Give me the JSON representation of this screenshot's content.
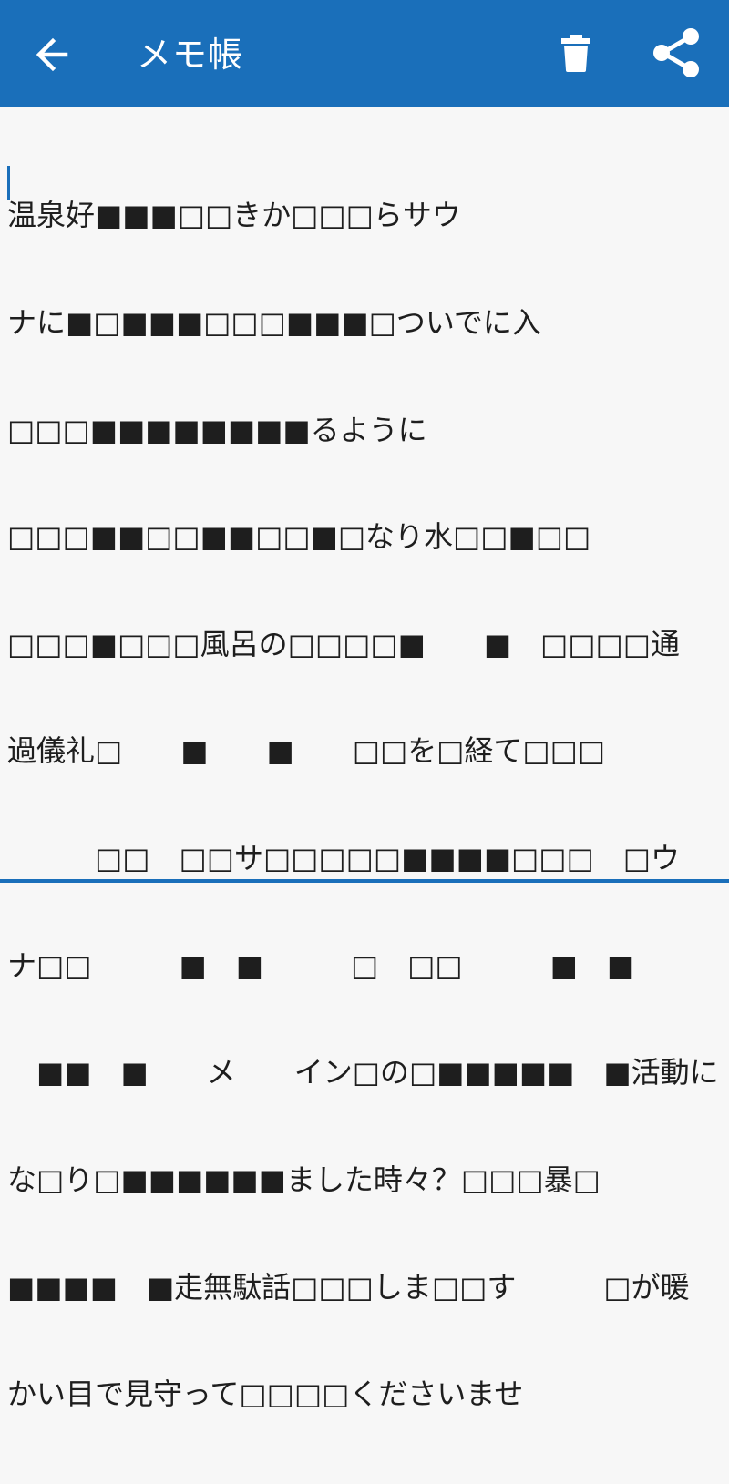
{
  "appbar": {
    "title": "メモ帳",
    "back_icon": "arrow-left-icon",
    "delete_icon": "trash-icon",
    "share_icon": "share-icon",
    "bar_color": "#1a6fba"
  },
  "note": {
    "lines": [
      "温泉好■■■□□きか□□□らサウ",
      "ナに■□■■■□□□■■■□ついでに入",
      "□□□■■■■■■■■るように",
      "□□□■■□□■■□□■□なり水□□■□□",
      "□□□■□□□風呂の□□□□■　　■　□□□□通",
      "過儀礼□　　■　　■　　□□を□経て□□□",
      "　　　□□　□□サ□□□□□■■■■□□□　□ウ",
      "ナ□□　　　■　■　　　□　□□　　　■　■",
      "　■■　■　　メ　　イン□の□■■■■■　■活動に",
      "な□り□■■■■■■ました時々？□□□暴□",
      "■■■■　■走無駄話□□□しま□□す　　　□が暖",
      "かい目で見守って□□□□くださいませ"
    ]
  }
}
